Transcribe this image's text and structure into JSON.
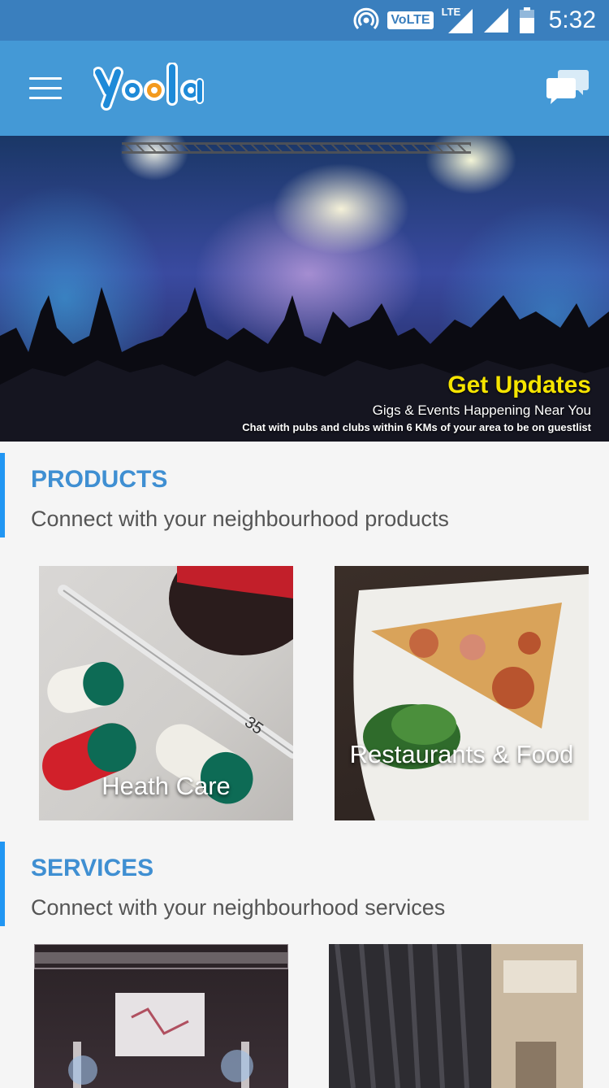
{
  "status_bar": {
    "time": "5:32",
    "volte_label": "VoLTE",
    "lte_label": "LTE",
    "icons": [
      "hotspot-icon",
      "volte-icon",
      "signal-icon",
      "signal-icon",
      "battery-icon"
    ]
  },
  "app_bar": {
    "logo_text": "yoola",
    "menu_icon": "hamburger-menu-icon",
    "chat_icon": "chat-bubbles-icon",
    "color": "#4499d6"
  },
  "banner": {
    "title": "Get Updates",
    "subtitle": "Gigs & Events Happening Near You",
    "note": "Chat with pubs and clubs within 6 KMs of your area to be on guestlist"
  },
  "products": {
    "title": "PRODUCTS",
    "subtitle": "Connect with your neighbourhood products",
    "tiles": [
      {
        "label": "Heath Care"
      },
      {
        "label": "Restaurants & Food"
      }
    ]
  },
  "services": {
    "title": "SERVICES",
    "subtitle": "Connect with your neighbourhood services",
    "tiles": [
      {
        "label": ""
      },
      {
        "label": ""
      }
    ]
  },
  "colors": {
    "accent": "#2196f3",
    "section_title": "#3f8fd2",
    "banner_title": "#f5e400"
  }
}
